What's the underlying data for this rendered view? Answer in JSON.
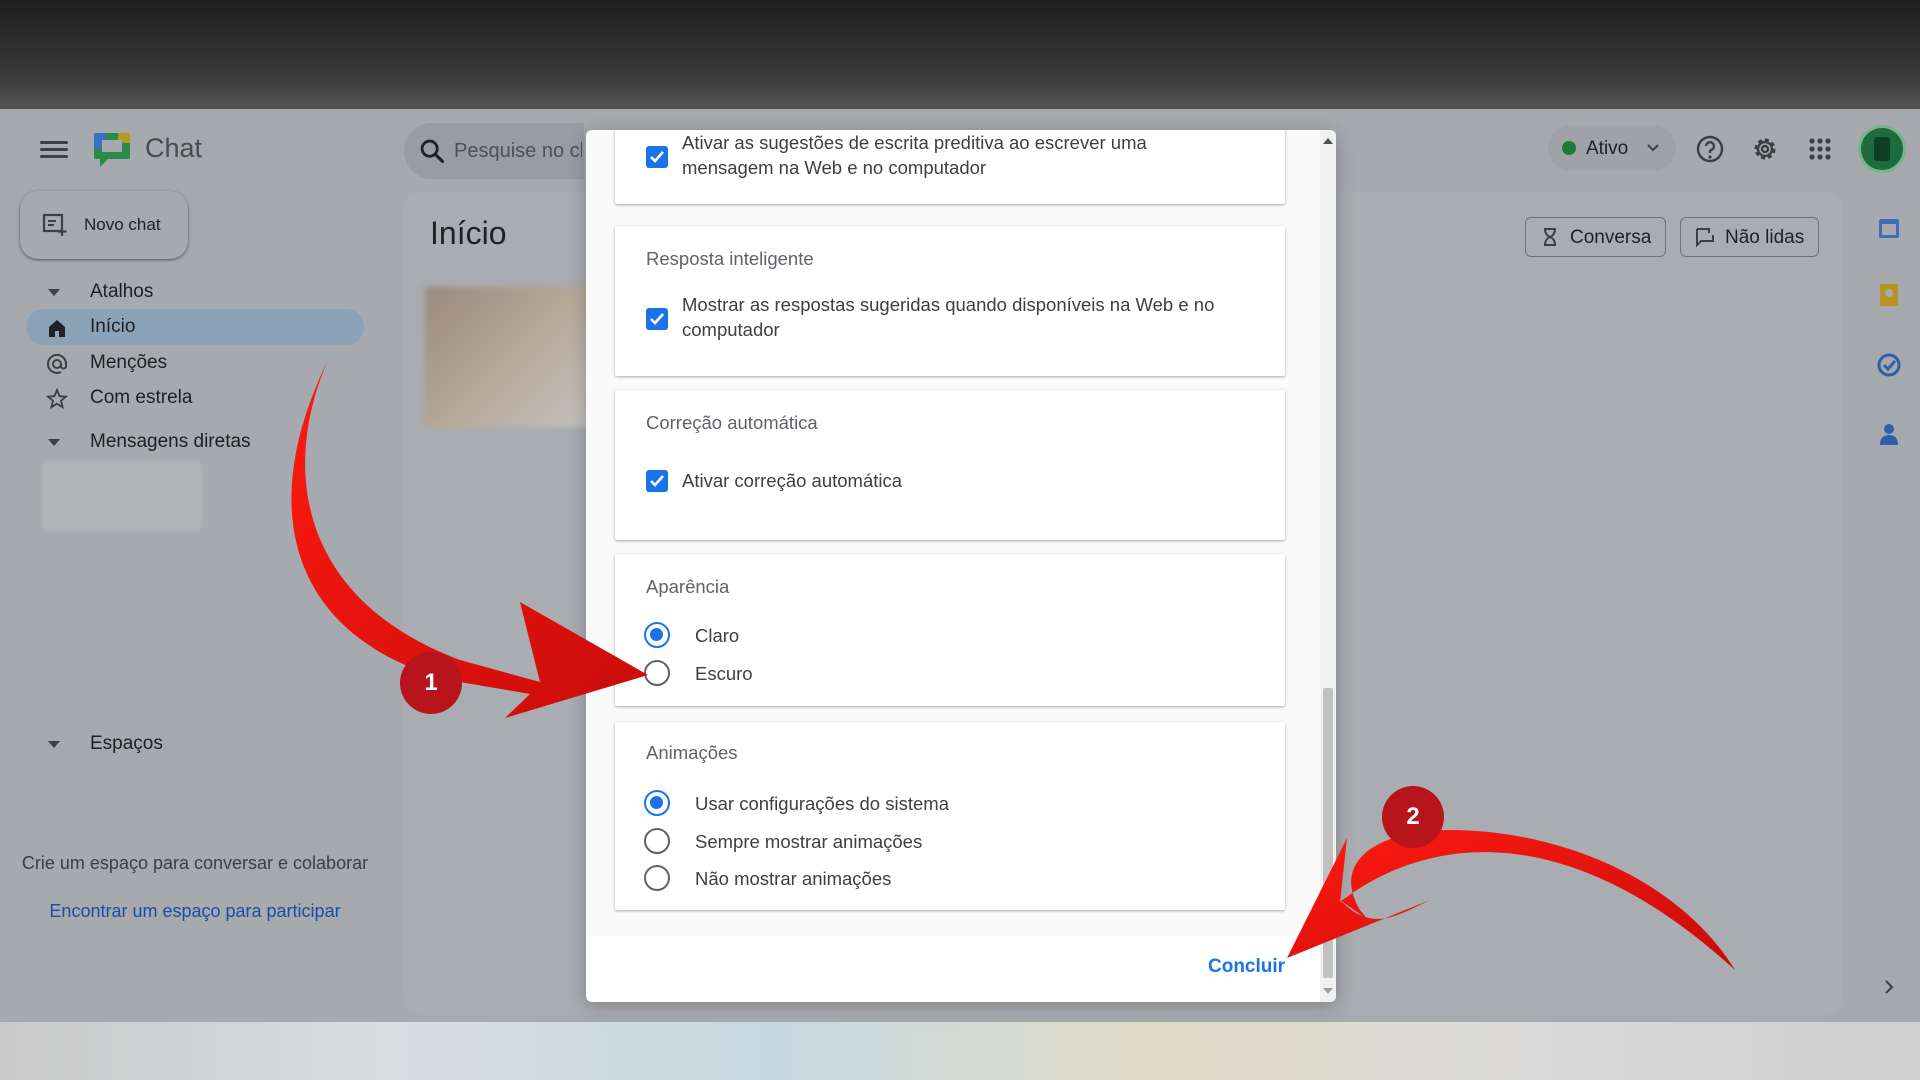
{
  "app": {
    "title": "Chat",
    "search_placeholder": "Pesquise no ch",
    "status_label": "Ativo"
  },
  "sidebar": {
    "new_chat_label": "Novo chat",
    "shortcuts_header": "Atalhos",
    "items": [
      {
        "label": "Início",
        "icon": "home-icon",
        "active": true
      },
      {
        "label": "Menções",
        "icon": "at-icon",
        "active": false
      },
      {
        "label": "Com estrela",
        "icon": "star-icon",
        "active": false
      }
    ],
    "direct_messages_header": "Mensagens diretas",
    "spaces_header": "Espaços",
    "spaces_note": "Crie um espaço para conversar e colaborar",
    "spaces_link": "Encontrar um espaço para participar"
  },
  "main": {
    "page_title": "Início",
    "chip_conversation": "Conversa",
    "chip_unread": "Não lidas"
  },
  "settings_dialog": {
    "predictive": {
      "checked": true,
      "text": "Ativar as sugestões de escrita preditiva ao escrever uma mensagem na Web e no computador"
    },
    "smart_reply": {
      "title": "Resposta inteligente",
      "checked": true,
      "text": "Mostrar as respostas sugeridas quando disponíveis na Web e no computador"
    },
    "autocorrect": {
      "title": "Correção automática",
      "checked": true,
      "text": "Ativar correção automática"
    },
    "appearance": {
      "title": "Aparência",
      "options": [
        {
          "label": "Claro",
          "selected": true
        },
        {
          "label": "Escuro",
          "selected": false
        }
      ]
    },
    "animations": {
      "title": "Animações",
      "options": [
        {
          "label": "Usar configurações do sistema",
          "selected": true
        },
        {
          "label": "Sempre mostrar animações",
          "selected": false
        },
        {
          "label": "Não mostrar animações",
          "selected": false
        }
      ]
    },
    "done_label": "Concluir"
  },
  "annotations": {
    "marker_1": "1",
    "marker_2": "2",
    "color": "#e3100f"
  },
  "colors": {
    "accent": "#1a73e8",
    "annotation_red": "#e3100f",
    "marker_red": "#b8141c"
  }
}
